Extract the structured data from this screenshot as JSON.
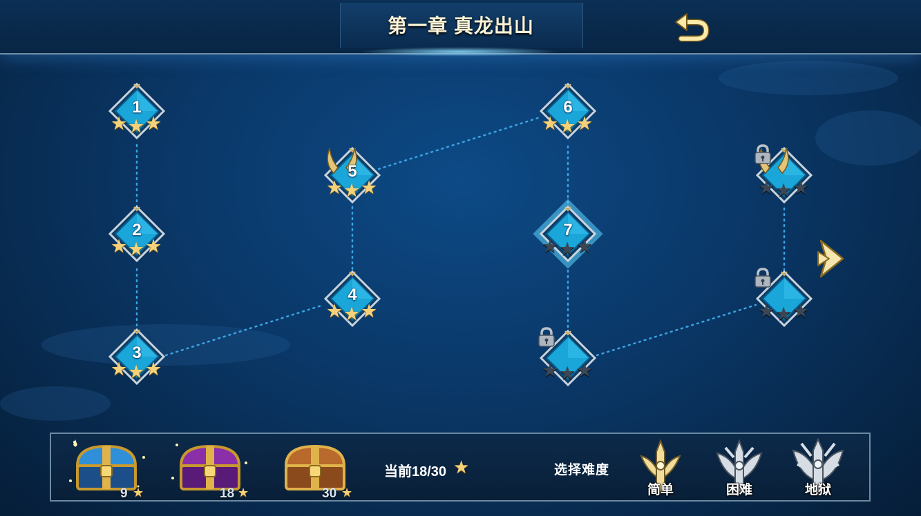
{
  "header": {
    "title": "第一章 真龙出山",
    "back_icon": "back-arrow-icon"
  },
  "levels": [
    {
      "id": "level-1",
      "number": "1",
      "stars": 3,
      "locked": false,
      "boss": false,
      "current": false
    },
    {
      "id": "level-2",
      "number": "2",
      "stars": 3,
      "locked": false,
      "boss": false,
      "current": false
    },
    {
      "id": "level-3",
      "number": "3",
      "stars": 3,
      "locked": false,
      "boss": false,
      "current": false
    },
    {
      "id": "level-4",
      "number": "4",
      "stars": 3,
      "locked": false,
      "boss": false,
      "current": false
    },
    {
      "id": "level-5",
      "number": "5",
      "stars": 3,
      "locked": false,
      "boss": true,
      "current": false
    },
    {
      "id": "level-6",
      "number": "6",
      "stars": 3,
      "locked": false,
      "boss": false,
      "current": false
    },
    {
      "id": "level-7",
      "number": "7",
      "stars": 0,
      "locked": false,
      "boss": false,
      "current": true
    },
    {
      "id": "level-8",
      "number": "",
      "stars": 0,
      "locked": true,
      "boss": false,
      "current": false
    },
    {
      "id": "level-9",
      "number": "",
      "stars": 0,
      "locked": true,
      "boss": false,
      "current": false
    },
    {
      "id": "level-10",
      "number": "",
      "stars": 0,
      "locked": true,
      "boss": true,
      "current": false
    }
  ],
  "next_icon": "chevron-right-icon",
  "rewards": {
    "chests": [
      {
        "name": "blue-chest",
        "count": "9",
        "color": "#2f8fd8"
      },
      {
        "name": "purple-chest",
        "count": "18",
        "color": "#8a2fa8"
      },
      {
        "name": "bronze-chest",
        "count": "30",
        "color": "#b8692c"
      }
    ],
    "progress_label": "当前18/30",
    "progress": {
      "current": 18,
      "total": 30
    }
  },
  "difficulty": {
    "label": "选择难度",
    "options": [
      {
        "label": "简单",
        "selected": true
      },
      {
        "label": "困难",
        "selected": false
      },
      {
        "label": "地狱",
        "selected": false
      }
    ]
  },
  "colors": {
    "star_on": "#f5d27a",
    "star_off": "#3b4754",
    "node_fill": "#1aa6d8",
    "gold_accent": "#f1dc9a"
  }
}
